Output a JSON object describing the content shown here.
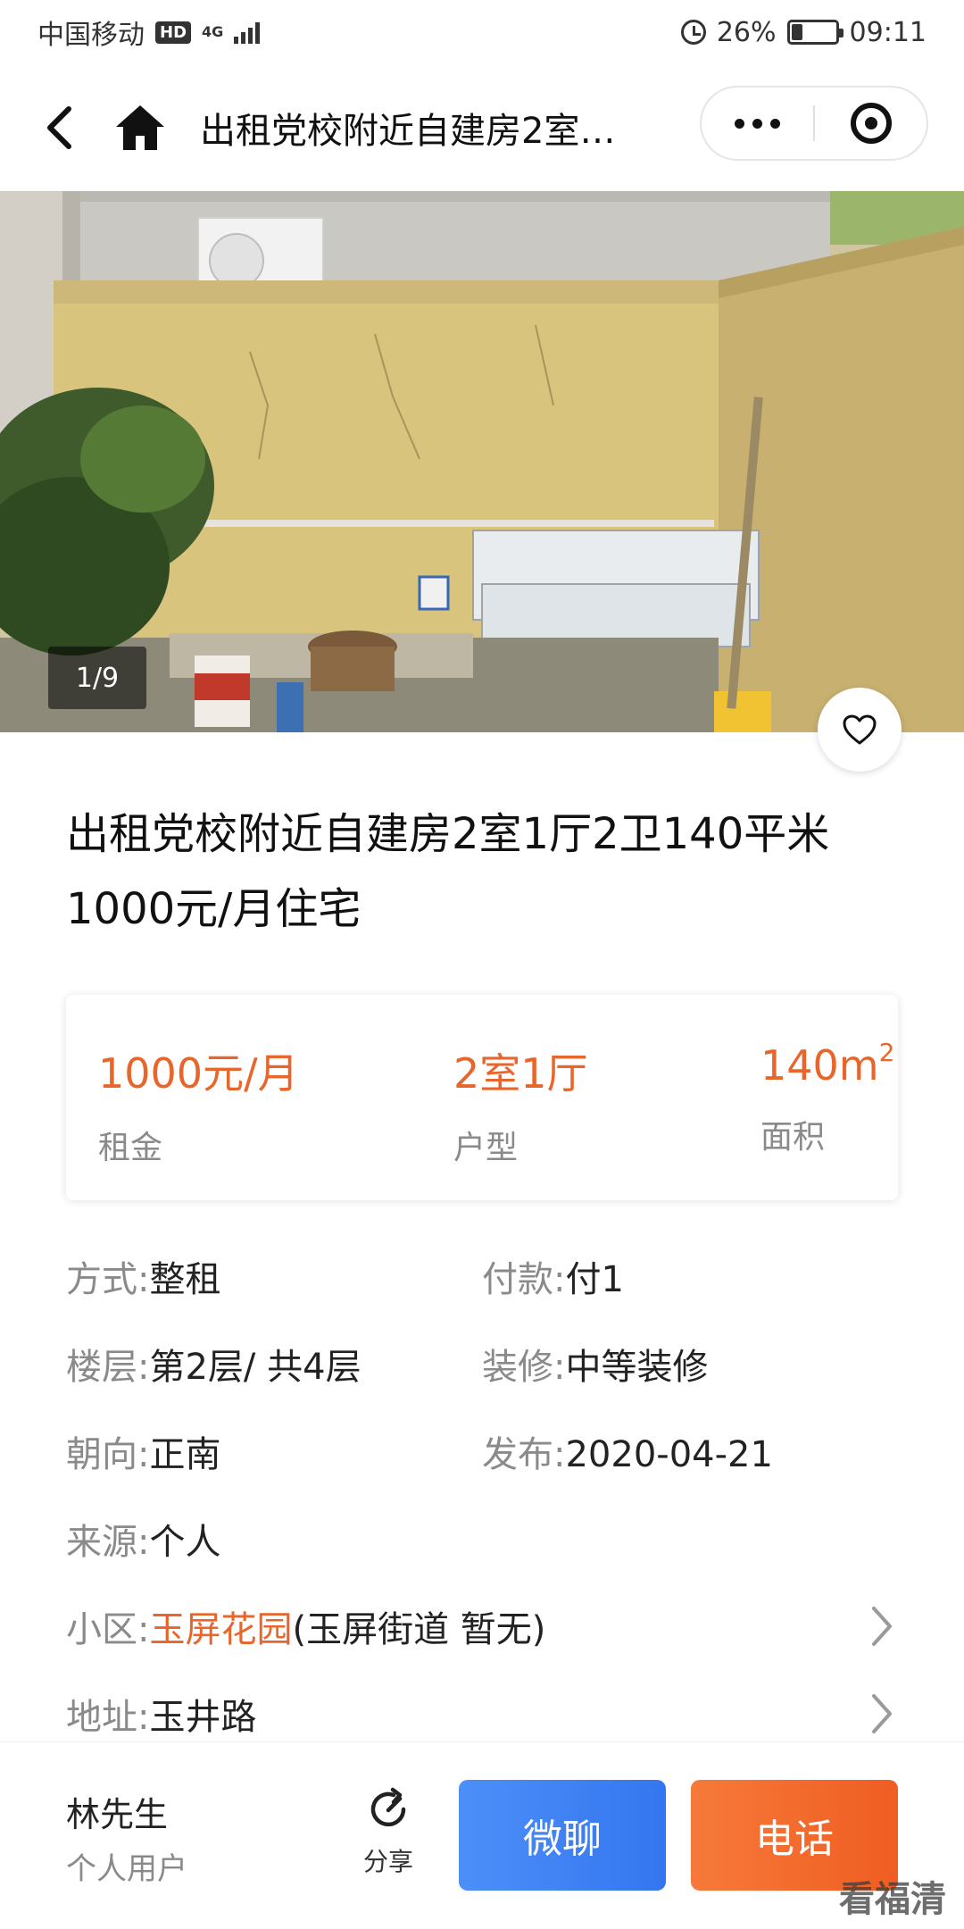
{
  "status_bar": {
    "carrier": "中国移动",
    "hd": "HD",
    "network": "4G",
    "battery": "26%",
    "battery_level": 0.26,
    "time": "09:11"
  },
  "nav": {
    "title": "出租党校附近自建房2室…"
  },
  "gallery": {
    "counter": "1/9"
  },
  "listing": {
    "title": "出租党校附近自建房2室1厅2卫140平米1000元/月住宅"
  },
  "summary": {
    "rent_value": "1000元/月",
    "rent_label": "租金",
    "layout_value": "2室1厅",
    "layout_label": "户型",
    "area_value": "140m",
    "area_sup": "2",
    "area_label": "面积"
  },
  "details": {
    "method_key": "方式:",
    "method_val": "整租",
    "payment_key": "付款:",
    "payment_val": "付1",
    "floor_key": "楼层:",
    "floor_val": "第2层/ 共4层",
    "decoration_key": "装修:",
    "decoration_val": "中等装修",
    "orientation_key": "朝向:",
    "orientation_val": "正南",
    "published_key": "发布:",
    "published_val": "2020-04-21",
    "source_key": "来源:",
    "source_val": "个人",
    "community_key": "小区:",
    "community_link": "玉屏花园",
    "community_extra": "(玉屏街道  暂无)",
    "address_key": "地址:",
    "address_val": "玉井路"
  },
  "bottom": {
    "contact_name": "林先生",
    "contact_type": "个人用户",
    "share_label": "分享",
    "chat_label": "微聊",
    "call_label": "电话"
  },
  "watermark": "看福清",
  "colors": {
    "accent": "#e8662b",
    "chat": "#3d82f4",
    "call": "#f26a2c"
  }
}
